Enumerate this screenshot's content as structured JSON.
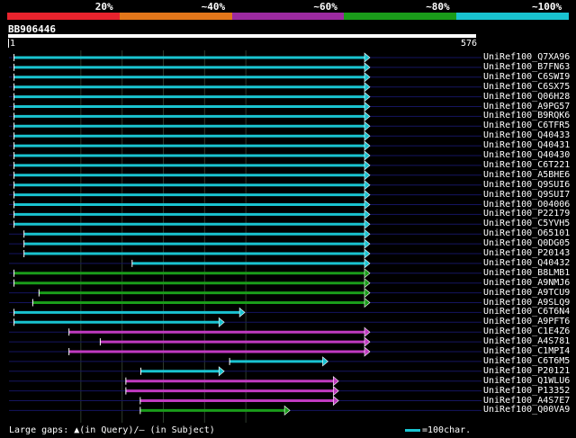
{
  "header": {
    "identity_bands": [
      {
        "label": "20%",
        "color": "#e8232d"
      },
      {
        "label": "~40%",
        "color": "#e2761a"
      },
      {
        "label": "~60%",
        "color": "#9c2aa0"
      },
      {
        "label": "~80%",
        "color": "#1a9c1a"
      },
      {
        "label": "~100%",
        "color": "#19c3d0"
      }
    ]
  },
  "query": {
    "name": "BB906446",
    "start": "1",
    "end": "576",
    "length": 576
  },
  "hits": [
    {
      "label": "UniRef100_Q7XA96",
      "start": 8,
      "end": 576,
      "color": "#19c3d0",
      "arrow": true
    },
    {
      "label": "UniRef100_B7FN63",
      "start": 8,
      "end": 576,
      "color": "#19c3d0",
      "arrow": true
    },
    {
      "label": "UniRef100_C6SWI9",
      "start": 8,
      "end": 576,
      "color": "#19c3d0",
      "arrow": true
    },
    {
      "label": "UniRef100_C6SX75",
      "start": 8,
      "end": 576,
      "color": "#19c3d0",
      "arrow": true
    },
    {
      "label": "UniRef100_Q06H28",
      "start": 8,
      "end": 576,
      "color": "#19c3d0",
      "arrow": true
    },
    {
      "label": "UniRef100_A9PG57",
      "start": 8,
      "end": 576,
      "color": "#19c3d0",
      "arrow": true
    },
    {
      "label": "UniRef100_B9RQK6",
      "start": 8,
      "end": 576,
      "color": "#19c3d0",
      "arrow": true
    },
    {
      "label": "UniRef100_C6TFR5",
      "start": 8,
      "end": 576,
      "color": "#19c3d0",
      "arrow": true
    },
    {
      "label": "UniRef100_Q40433",
      "start": 8,
      "end": 576,
      "color": "#19c3d0",
      "arrow": true
    },
    {
      "label": "UniRef100_Q40431",
      "start": 8,
      "end": 576,
      "color": "#19c3d0",
      "arrow": true
    },
    {
      "label": "UniRef100_Q40430",
      "start": 8,
      "end": 576,
      "color": "#19c3d0",
      "arrow": true
    },
    {
      "label": "UniRef100_C6T221",
      "start": 8,
      "end": 576,
      "color": "#19c3d0",
      "arrow": true
    },
    {
      "label": "UniRef100_A5BHE6",
      "start": 8,
      "end": 576,
      "color": "#19c3d0",
      "arrow": true
    },
    {
      "label": "UniRef100_Q9SUI6",
      "start": 8,
      "end": 576,
      "color": "#19c3d0",
      "arrow": true
    },
    {
      "label": "UniRef100_Q9SUI7",
      "start": 8,
      "end": 576,
      "color": "#19c3d0",
      "arrow": true
    },
    {
      "label": "UniRef100_O04006",
      "start": 8,
      "end": 576,
      "color": "#19c3d0",
      "arrow": true
    },
    {
      "label": "UniRef100_P22179",
      "start": 8,
      "end": 576,
      "color": "#19c3d0",
      "arrow": true
    },
    {
      "label": "UniRef100_C5YVH5",
      "start": 8,
      "end": 576,
      "color": "#19c3d0",
      "arrow": true
    },
    {
      "label": "UniRef100_O65101",
      "start": 24,
      "end": 576,
      "color": "#19c3d0",
      "arrow": true
    },
    {
      "label": "UniRef100_Q0DG05",
      "start": 24,
      "end": 576,
      "color": "#19c3d0",
      "arrow": true
    },
    {
      "label": "UniRef100_P20143",
      "start": 24,
      "end": 576,
      "color": "#19c3d0",
      "arrow": true
    },
    {
      "label": "UniRef100_Q40432",
      "start": 197,
      "end": 576,
      "color": "#19c3d0",
      "arrow": true
    },
    {
      "label": "UniRef100_B8LMB1",
      "start": 8,
      "end": 576,
      "color": "#1a9c1a",
      "arrow": true
    },
    {
      "label": "UniRef100_A9NMJ6",
      "start": 8,
      "end": 576,
      "color": "#1a9c1a",
      "arrow": true
    },
    {
      "label": "UniRef100_A9TCU9",
      "start": 48,
      "end": 576,
      "color": "#1a9c1a",
      "arrow": true
    },
    {
      "label": "UniRef100_A9SLQ9",
      "start": 38,
      "end": 576,
      "color": "#1a9c1a",
      "arrow": true
    },
    {
      "label": "UniRef100_C6T6N4",
      "start": 8,
      "end": 376,
      "color": "#19c3d0",
      "arrow": true
    },
    {
      "label": "UniRef100_A9PFT6",
      "start": 8,
      "end": 343,
      "color": "#19c3d0",
      "arrow": true
    },
    {
      "label": "UniRef100_C1E4Z6",
      "start": 96,
      "end": 576,
      "color": "#c03ac0",
      "arrow": true
    },
    {
      "label": "UniRef100_A4S781",
      "start": 146,
      "end": 576,
      "color": "#c03ac0",
      "arrow": true
    },
    {
      "label": "UniRef100_C1MPI4",
      "start": 96,
      "end": 576,
      "color": "#c03ac0",
      "arrow": true
    },
    {
      "label": "UniRef100_C6T6M5",
      "start": 353,
      "end": 509,
      "color": "#19c3d0",
      "arrow": true
    },
    {
      "label": "UniRef100_P20121",
      "start": 211,
      "end": 343,
      "color": "#19c3d0",
      "arrow": true
    },
    {
      "label": "UniRef100_Q1WLU6",
      "start": 187,
      "end": 526,
      "color": "#c03ac0",
      "arrow": true
    },
    {
      "label": "UniRef100_P13352",
      "start": 187,
      "end": 526,
      "color": "#c03ac0",
      "arrow": true
    },
    {
      "label": "UniRef100_A4S7E7",
      "start": 210,
      "end": 526,
      "color": "#c03ac0",
      "arrow": true
    },
    {
      "label": "UniRef100_Q00VA9",
      "start": 210,
      "end": 448,
      "color": "#1a9c1a",
      "arrow": true
    }
  ],
  "footer": {
    "legend_text": "Large gaps: ▲(in Query)/– (in Subject)",
    "scale_text": "=100char."
  }
}
